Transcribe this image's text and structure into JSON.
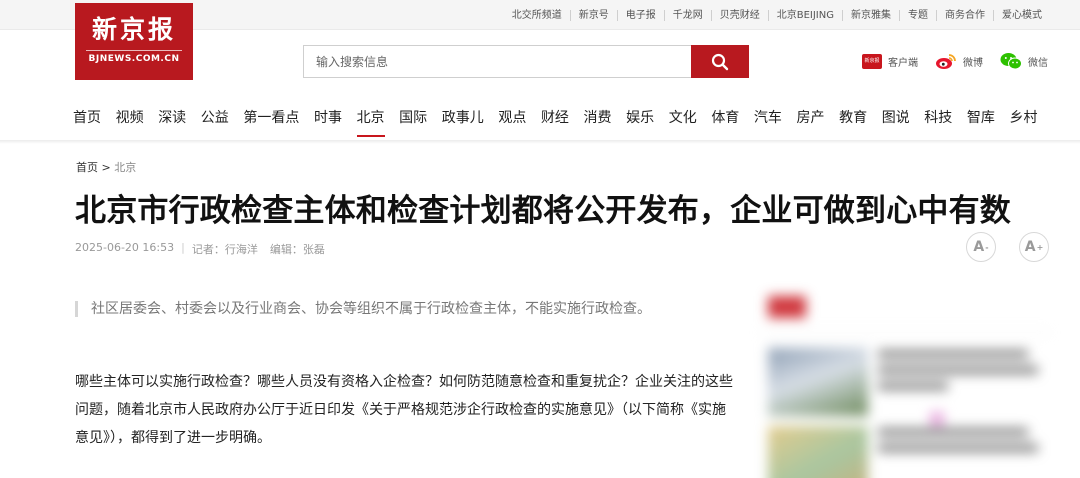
{
  "top_links": [
    "北交所频道",
    "新京号",
    "电子报",
    "千龙网",
    "贝壳财经",
    "北京BEIJING",
    "新京雅集",
    "专题",
    "商务合作",
    "爱心模式"
  ],
  "logo": {
    "cn": "新京报",
    "en": "BJNEWS.COM.CN"
  },
  "search": {
    "placeholder": "输入搜索信息",
    "button_icon": "search-icon"
  },
  "apps": [
    {
      "label": "客户端",
      "icon": "bjnews-app-icon",
      "icon_text": "新京报"
    },
    {
      "label": "微博",
      "icon": "weibo-icon"
    },
    {
      "label": "微信",
      "icon": "wechat-icon"
    }
  ],
  "nav": {
    "items": [
      "首页",
      "视频",
      "深读",
      "公益",
      "第一看点",
      "时事",
      "北京",
      "国际",
      "政事儿",
      "观点",
      "财经",
      "消费",
      "娱乐",
      "文化",
      "体育",
      "汽车",
      "房产",
      "教育",
      "图说",
      "科技",
      "智库",
      "乡村"
    ],
    "active": "北京"
  },
  "breadcrumb": {
    "home": "首页",
    "separator": ">",
    "current": "北京"
  },
  "article": {
    "title": "北京市行政检查主体和检查计划都将公开发布，企业可做到心中有数",
    "date": "2025-06-20 16:53",
    "reporter": "记者：行海洋",
    "editor": "编辑：张磊",
    "summary": "社区居委会、村委会以及行业商会、协会等组织不属于行政检查主体，不能实施行政检查。",
    "body": "哪些主体可以实施行政检查？哪些人员没有资格入企检查？如何防范随意检查和重复扰企？企业关注的这些问题，随着北京市人民政府办公厅于近日印发《关于严格规范涉企行政检查的实施意见》（以下简称《实施意见》），都得到了进一步明确。"
  },
  "font_controls": {
    "decrease": "A",
    "increase": "A",
    "decrease_mark": "-",
    "increase_mark": "+"
  },
  "colors": {
    "brand_red": "#b8191f",
    "nav_active": "#c8161d"
  }
}
